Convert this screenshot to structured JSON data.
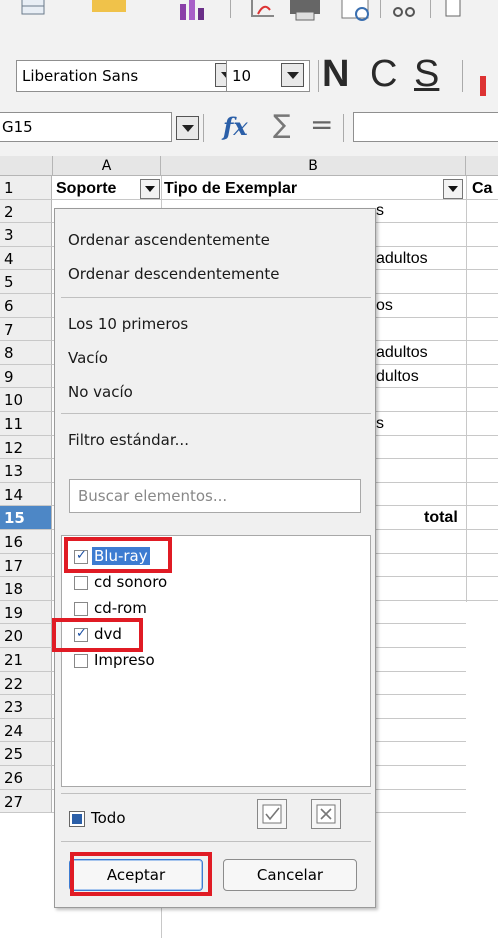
{
  "toolbar": {
    "font_name": "Liberation Sans",
    "font_size": "10",
    "bold_label": "N",
    "italic_label": "C",
    "underline_label": "S"
  },
  "formula_bar": {
    "cell_ref": "G15",
    "function_wizard_label": "fx",
    "sum_label": "∑",
    "equals_label": "="
  },
  "grid": {
    "columns": [
      "A",
      "B"
    ],
    "rows": [
      "1",
      "2",
      "3",
      "4",
      "5",
      "6",
      "7",
      "8",
      "9",
      "10",
      "11",
      "12",
      "13",
      "14",
      "15",
      "16",
      "17",
      "18",
      "19",
      "20",
      "21",
      "22",
      "23",
      "24",
      "25",
      "26",
      "27"
    ],
    "active_row": "15",
    "header_cells": {
      "a1": "Soporte",
      "b1": "Tipo de Exemplar",
      "c1": "Ca"
    },
    "partial_cells": {
      "b2": "s",
      "b4": "adultos",
      "b6": "os",
      "b8": "adultos",
      "b9": "dultos",
      "b11": "s",
      "b15": "total"
    }
  },
  "popup": {
    "sort_asc": "Ordenar ascendentemente",
    "sort_desc": "Ordenar descendentemente",
    "top10": "Los 10 primeros",
    "empty": "Vacío",
    "not_empty": "No vacío",
    "standard_filter": "Filtro estándar...",
    "search_placeholder": "Buscar elementos...",
    "items": [
      {
        "label": "Blu-ray",
        "checked": true,
        "selected": true
      },
      {
        "label": "cd sonoro",
        "checked": false,
        "selected": false
      },
      {
        "label": "cd-rom",
        "checked": false,
        "selected": false
      },
      {
        "label": "dvd",
        "checked": true,
        "selected": false
      },
      {
        "label": "Impreso",
        "checked": false,
        "selected": false
      }
    ],
    "all_label": "Todo",
    "ok_label": "Aceptar",
    "cancel_label": "Cancelar"
  },
  "colors": {
    "highlight": "#e01b24",
    "selection": "#3d7cd1",
    "active_row": "#4d87c6"
  }
}
